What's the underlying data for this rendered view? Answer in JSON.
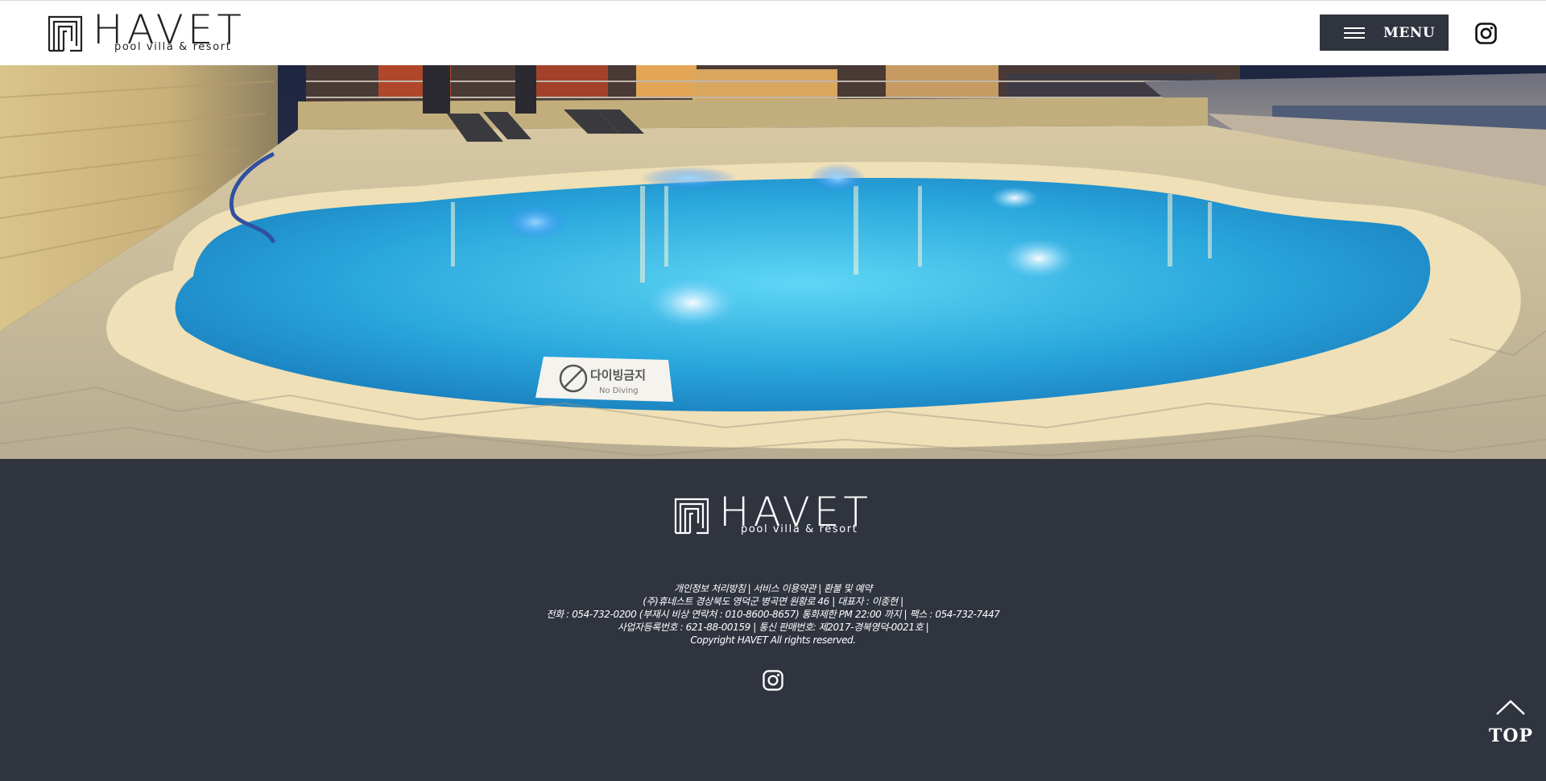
{
  "header": {
    "logo_word": "HAVET",
    "logo_sub": "pool villa & resort",
    "menu_label": "MENU"
  },
  "hero": {
    "sign_kr": "다이빙금지",
    "sign_en": "No Diving"
  },
  "footer": {
    "logo_word": "HAVET",
    "logo_sub": "pool villa & resort",
    "links": [
      "개인정보 처리방침",
      "서비스 이용약관",
      "환불 및 예약"
    ],
    "line2": "(주)휴네스트 경상북도 영덕군 병곡면 원황로 46 | 대표자 : 이종현 |",
    "line3": "전화 : 054-732-0200 (부재시 비상 연락처 : 010-8600-8657) 통화제한 PM 22:00 까지 | 팩스 : 054-732-7447",
    "line4": "사업자등록번호 : 621-88-00159 | 통신 판매번호: 제2017-경북영덕-0021호 |",
    "line5": "Copyright HAVET All rights reserved."
  },
  "top_button": {
    "label": "TOP"
  },
  "colors": {
    "footer_bg": "#2f343e",
    "menu_bg": "#2f343e",
    "header_bg": "#ffffff"
  },
  "icons": [
    "logo-mark-icon",
    "menu-icon",
    "instagram-icon",
    "no-diving-icon",
    "chevron-up-icon"
  ]
}
